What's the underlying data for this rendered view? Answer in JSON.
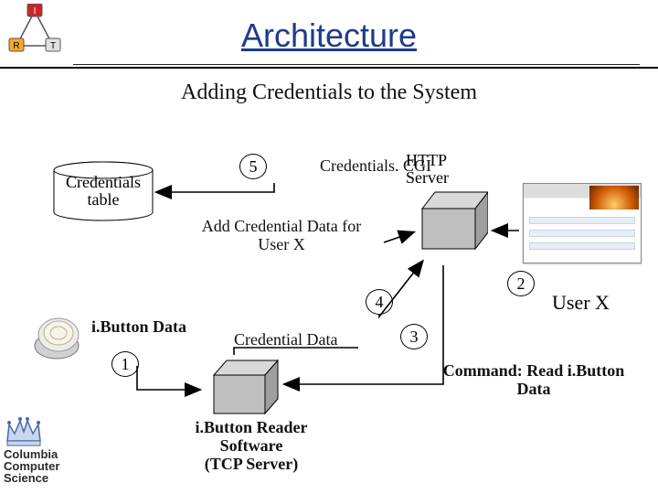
{
  "title": "Architecture",
  "subtitle": "Adding Credentials to the System",
  "irt": {
    "top": "I",
    "left": "R",
    "right": "T"
  },
  "db": {
    "line1": "Credentials",
    "line2": "table"
  },
  "steps": {
    "s1": "1",
    "s2": "2",
    "s3": "3",
    "s4": "4",
    "s5": "5"
  },
  "labels": {
    "credentials_cgi": "Credentials. CGI",
    "http_server_l1": "HTTP",
    "http_server_l2": "Server",
    "add_cred_l1": "Add Credential Data for",
    "add_cred_l2": "User X",
    "ibutton_data": "i.Button Data",
    "credential_data": "Credential Data",
    "reader_l1": "i.Button Reader",
    "reader_l2": "Software",
    "reader_l3": "(TCP Server)",
    "command_l1": "Command: Read i.Button",
    "command_l2": "Data",
    "user_x": "User X"
  },
  "columbia": {
    "l1": "Columbia",
    "l2": "Computer",
    "l3": "Science"
  }
}
